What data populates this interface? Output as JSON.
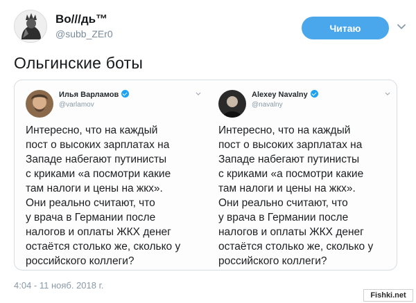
{
  "header": {
    "author_name": "Bo///дь™",
    "author_handle": "@subb_ZEr0",
    "follow_label": "Читаю"
  },
  "tweet": {
    "text": "Ольгинские боты",
    "timestamp": "4:04 - 11 нояб. 2018 г."
  },
  "screenshot": {
    "left": {
      "name": "Илья Варламов",
      "handle": "@varlamov",
      "body": "Интересно, что на каждый\nпост о высоких зарплатах на\nЗападе набегают путинисты\nс криками «а посмотри какие\nтам налоги и цены на жкх».\nОни реально считают, что\nу врача в Германии после\nналогов и оплаты ЖКХ денег\nостаётся столько же, сколько у\nроссийского коллеги?"
    },
    "right": {
      "name": "Alexey Navalny",
      "handle": "@navalny",
      "body": "Интересно, что на каждый\nпост о высоких зарплатах на\nЗападе набегают путинисты\nс криками «а посмотри какие\nтам налоги и цены на жкх».\nОни реально считают, что\nу врача в Германии после\nналогов и оплаты ЖКХ денег\nостаётся столько же, сколько у\nроссийского коллеги?"
    }
  },
  "watermark": "Fishki.net",
  "colors": {
    "follow_button": "#4aa7ec",
    "verified": "#1da1f2",
    "muted_text": "#8899a6"
  },
  "icons": {
    "chevron": "chevron-down-icon",
    "verified": "verified-badge-icon"
  }
}
